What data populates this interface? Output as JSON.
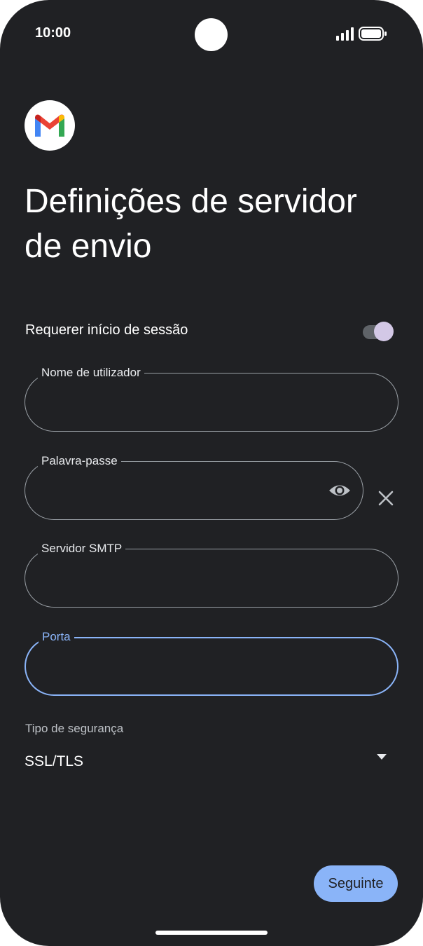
{
  "status_bar": {
    "time": "10:00"
  },
  "app": {
    "logo_icon": "gmail-logo-icon"
  },
  "header": {
    "title": "Definições de servidor de envio"
  },
  "signin_toggle": {
    "label": "Requerer início de sessão",
    "enabled": true
  },
  "fields": {
    "username": {
      "label": "Nome de utilizador",
      "value": ""
    },
    "password": {
      "label": "Palavra-passe",
      "value": ""
    },
    "smtp_server": {
      "label": "Servidor SMTP",
      "value": ""
    },
    "port": {
      "label": "Porta",
      "value": "",
      "focused": true
    }
  },
  "security": {
    "label": "Tipo de segurança",
    "selected": "SSL/TLS"
  },
  "actions": {
    "next_label": "Seguinte"
  },
  "colors": {
    "background": "#202124",
    "accent": "#8ab4f8",
    "toggle_thumb": "#d3c8e6"
  }
}
